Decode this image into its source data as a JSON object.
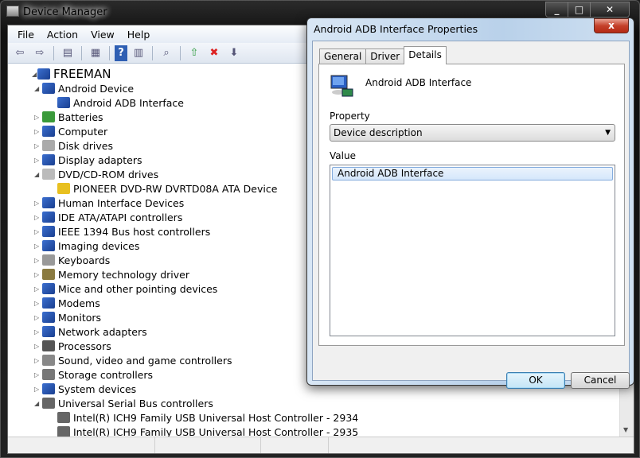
{
  "main_window": {
    "title": "Device Manager",
    "caption_buttons": [
      "minimize",
      "maximize",
      "close"
    ]
  },
  "menu": [
    "File",
    "Action",
    "View",
    "Help"
  ],
  "toolbar": [
    "back-icon",
    "forward-icon",
    "show-hide-console-tree-icon",
    "properties-icon",
    "help-icon",
    "action-pane-icon",
    "scan-hardware-icon",
    "update-driver-icon",
    "disable-device-icon",
    "uninstall-device-icon"
  ],
  "tree": [
    {
      "level": 0,
      "label": "FREEMAN",
      "expanded": true,
      "icon": "computer-icon"
    },
    {
      "level": 1,
      "label": "Android Device",
      "expanded": true,
      "icon": "device-icon"
    },
    {
      "level": 2,
      "label": "Android ADB Interface",
      "icon": "device-icon"
    },
    {
      "level": 1,
      "label": "Batteries",
      "expanded": false,
      "icon": "battery-icon"
    },
    {
      "level": 1,
      "label": "Computer",
      "expanded": false,
      "icon": "computer-icon"
    },
    {
      "level": 1,
      "label": "Disk drives",
      "expanded": false,
      "icon": "disk-icon"
    },
    {
      "level": 1,
      "label": "Display adapters",
      "expanded": false,
      "icon": "display-icon"
    },
    {
      "level": 1,
      "label": "DVD/CD-ROM drives",
      "expanded": true,
      "icon": "dvd-icon"
    },
    {
      "level": 2,
      "label": "PIONEER DVD-RW  DVRTD08A ATA Device",
      "icon": "dvd-warning-icon"
    },
    {
      "level": 1,
      "label": "Human Interface Devices",
      "expanded": false,
      "icon": "hid-icon"
    },
    {
      "level": 1,
      "label": "IDE ATA/ATAPI controllers",
      "expanded": false,
      "icon": "ide-icon"
    },
    {
      "level": 1,
      "label": "IEEE 1394 Bus host controllers",
      "expanded": false,
      "icon": "firewire-icon"
    },
    {
      "level": 1,
      "label": "Imaging devices",
      "expanded": false,
      "icon": "camera-icon"
    },
    {
      "level": 1,
      "label": "Keyboards",
      "expanded": false,
      "icon": "keyboard-icon"
    },
    {
      "level": 1,
      "label": "Memory technology driver",
      "expanded": false,
      "icon": "memory-icon"
    },
    {
      "level": 1,
      "label": "Mice and other pointing devices",
      "expanded": false,
      "icon": "mouse-icon"
    },
    {
      "level": 1,
      "label": "Modems",
      "expanded": false,
      "icon": "modem-icon"
    },
    {
      "level": 1,
      "label": "Monitors",
      "expanded": false,
      "icon": "monitor-icon"
    },
    {
      "level": 1,
      "label": "Network adapters",
      "expanded": false,
      "icon": "network-icon"
    },
    {
      "level": 1,
      "label": "Processors",
      "expanded": false,
      "icon": "processor-icon"
    },
    {
      "level": 1,
      "label": "Sound, video and game controllers",
      "expanded": false,
      "icon": "speaker-icon"
    },
    {
      "level": 1,
      "label": "Storage controllers",
      "expanded": false,
      "icon": "storage-icon"
    },
    {
      "level": 1,
      "label": "System devices",
      "expanded": false,
      "icon": "system-icon"
    },
    {
      "level": 1,
      "label": "Universal Serial Bus controllers",
      "expanded": true,
      "icon": "usb-icon"
    },
    {
      "level": 2,
      "label": "Intel(R) ICH9 Family USB Universal Host Controller - 2934",
      "icon": "usb-icon"
    },
    {
      "level": 2,
      "label": "Intel(R) ICH9 Family USB Universal Host Controller - 2935",
      "icon": "usb-icon"
    }
  ],
  "dialog": {
    "title": "Android ADB Interface Properties",
    "close": "x",
    "tabs": [
      "General",
      "Driver",
      "Details"
    ],
    "active_tab": "Details",
    "device_name": "Android ADB Interface",
    "property_label": "Property",
    "property_value": "Device description",
    "value_label": "Value",
    "value_item": "Android ADB Interface",
    "ok": "OK",
    "cancel": "Cancel"
  }
}
